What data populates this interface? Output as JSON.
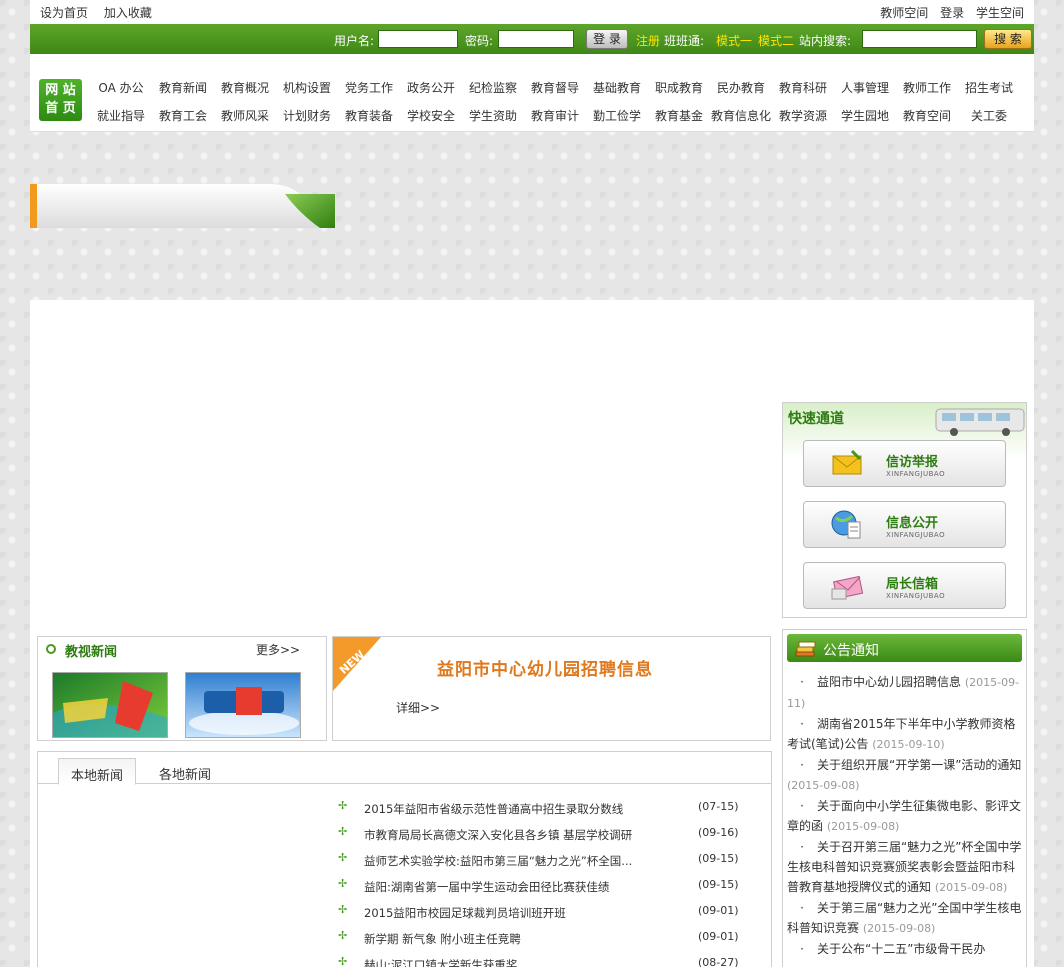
{
  "topbar": {
    "set_home": "设为首页",
    "add_fav": "加入收藏",
    "teacher_space": "教师空间",
    "login": "登录",
    "student_space": "学生空间"
  },
  "loginbar": {
    "username_label": "用户名:",
    "password_label": "密码:",
    "login_button": "登 录",
    "register": "注册",
    "banbantong": "班班通:",
    "mode1": "模式一",
    "mode2": "模式二",
    "site_search": "站内搜索:",
    "search_button": "搜 索"
  },
  "nav": {
    "home_line1": "网 站",
    "home_line2": "首 页",
    "row1": [
      "OA 办公",
      "教育新闻",
      "教育概况",
      "机构设置",
      "党务工作",
      "政务公开",
      "纪检监察",
      "教育督导",
      "基础教育",
      "职成教育",
      "民办教育",
      "教育科研",
      "人事管理",
      "教师工作",
      "招生考试"
    ],
    "row2": [
      "就业指导",
      "教育工会",
      "教师风采",
      "计划财务",
      "教育装备",
      "学校安全",
      "学生资助",
      "教育审计",
      "勤工俭学",
      "教育基金",
      "教育信息化",
      "教学资源",
      "学生园地",
      "教育空间",
      "关工委"
    ]
  },
  "quick": {
    "title": "快速通道",
    "items": [
      {
        "title": "信访举报",
        "sub": "XINFANGJUBAO"
      },
      {
        "title": "信息公开",
        "sub": "XINFANGJUBAO"
      },
      {
        "title": "局长信箱",
        "sub": "XINFANGJUBAO"
      }
    ]
  },
  "jiaoshi": {
    "title": "教视新闻",
    "more": "更多>>"
  },
  "newbox": {
    "badge": "NEW",
    "headline": "益阳市中心幼儿园招聘信息",
    "detail": "详细>>"
  },
  "news": {
    "tab_local": "本地新闻",
    "tab_other": "各地新闻",
    "items": [
      {
        "title": "2015年益阳市省级示范性普通高中招生录取分数线",
        "date": "(07-15)"
      },
      {
        "title": "市教育局局长高德文深入安化县各乡镇 基层学校调研",
        "date": "(09-16)"
      },
      {
        "title": "益师艺术实验学校:益阳市第三届“魅力之光”杯全国...",
        "date": "(09-15)"
      },
      {
        "title": "益阳:湖南省第一届中学生运动会田径比赛获佳绩",
        "date": "(09-15)"
      },
      {
        "title": "2015益阳市校园足球裁判员培训班开班",
        "date": "(09-01)"
      },
      {
        "title": "新学期 新气象 附小班主任竞聘",
        "date": "(09-01)"
      },
      {
        "title": "赫山:泥江口镇大学新生获重奖",
        "date": "(08-27)"
      }
    ]
  },
  "notice": {
    "title": "公告通知",
    "items": [
      {
        "title": "益阳市中心幼儿园招聘信息",
        "date": "(2015-09-11)"
      },
      {
        "title": "湖南省2015年下半年中小学教师资格考试(笔试)公告",
        "date": "(2015-09-10)"
      },
      {
        "title": "关于组织开展“开学第一课”活动的通知",
        "date": "(2015-09-08)"
      },
      {
        "title": "关于面向中小学生征集微电影、影评文章的函",
        "date": "(2015-09-08)"
      },
      {
        "title": "关于召开第三届“魅力之光”杯全国中学生核电科普知识竞赛颁奖表彰会暨益阳市科普教育基地授牌仪式的通知",
        "date": "(2015-09-08)"
      },
      {
        "title": "关于第三届“魅力之光”全国中学生核电科普知识竞赛",
        "date": "(2015-09-08)"
      },
      {
        "title": "关于公布“十二五”市级骨干民办",
        "date": ""
      }
    ]
  }
}
